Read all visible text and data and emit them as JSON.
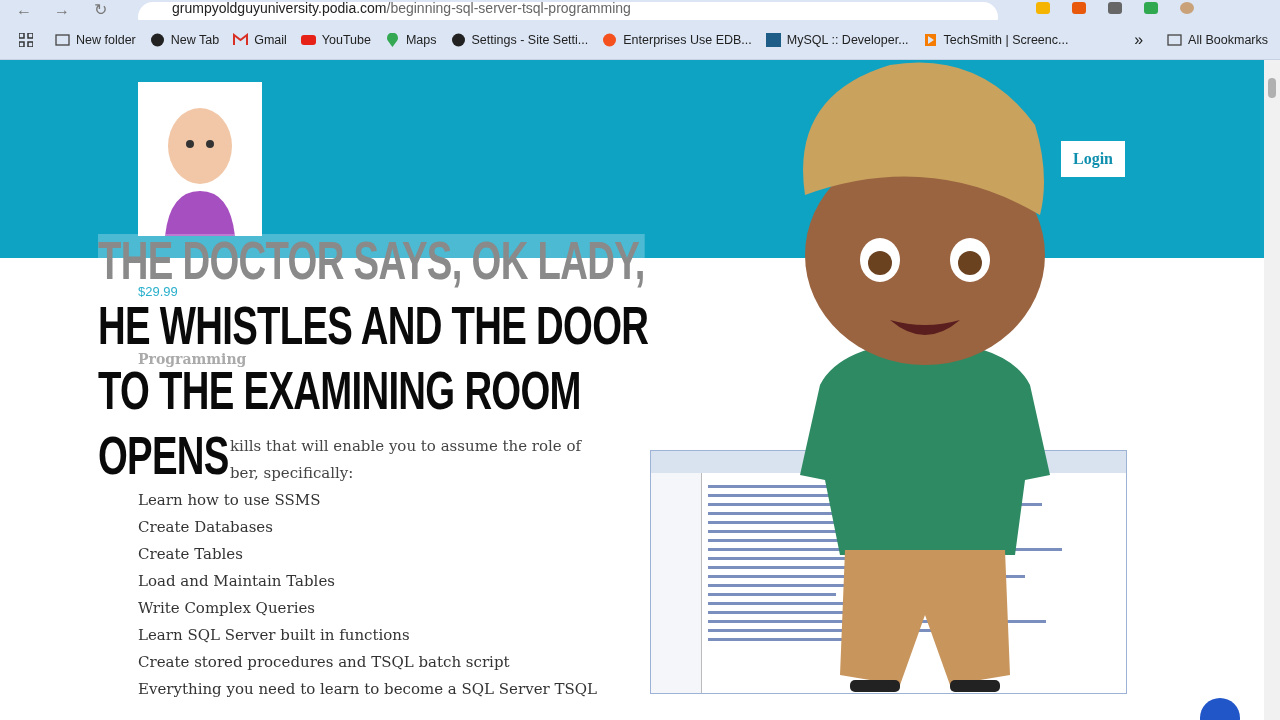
{
  "browser": {
    "nav": [
      "←",
      "→",
      "↻"
    ],
    "url_host": "grumpyoldguyuniversity.podia.com",
    "url_path": "/beginning-sql-server-tsql-programming",
    "bookmarks": [
      {
        "label": "New folder",
        "kind": "folder"
      },
      {
        "label": "New Tab",
        "kind": "globe"
      },
      {
        "label": "Gmail",
        "kind": "mail"
      },
      {
        "label": "YouTube",
        "kind": "video"
      },
      {
        "label": "Maps",
        "kind": "pin"
      },
      {
        "label": "Settings - Site Setti...",
        "kind": "gear"
      },
      {
        "label": "Enterprises Use EDB...",
        "kind": "dot"
      },
      {
        "label": "MySQL :: Developer...",
        "kind": "square"
      },
      {
        "label": "TechSmith | Screenc...",
        "kind": "play"
      }
    ],
    "more": "»",
    "all_bookmarks": "All Bookmarks"
  },
  "page": {
    "login": "Login",
    "price": "$29.99",
    "title": "Programming",
    "intro": [
      "kills that will enable you to assume the role of",
      "ber, specifically:"
    ],
    "items": [
      "Learn how to use SSMS",
      "Create Databases",
      "Create Tables",
      "Load and Maintain Tables",
      "Write Complex Queries",
      "Learn SQL Server built in functions",
      "Create stored procedures and TSQL batch script",
      "Everything you need to learn to become a SQL Server TSQL"
    ]
  },
  "caption": [
    {
      "text": "THE DOCTOR SAYS, OK LADY,",
      "faded": true
    },
    {
      "text": "HE WHISTLES AND THE DOOR",
      "faded": false
    },
    {
      "text": "TO THE EXAMINING ROOM",
      "faded": false
    },
    {
      "text": "OPENS",
      "faded": false
    }
  ]
}
